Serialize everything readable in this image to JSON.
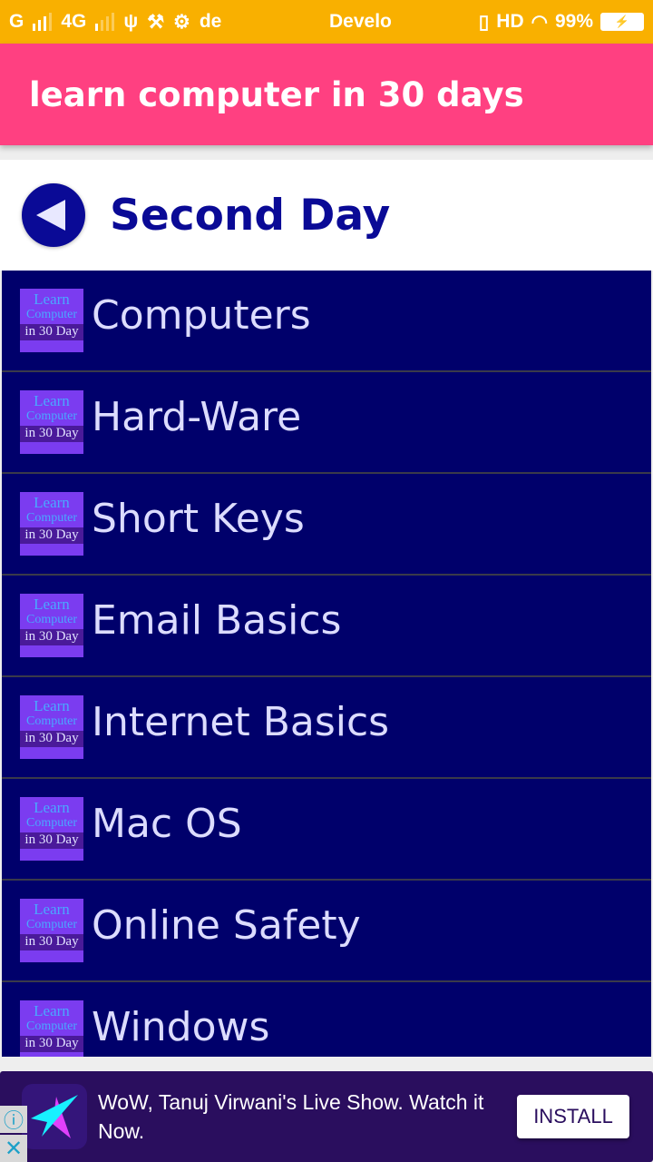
{
  "status_bar": {
    "network1": "G",
    "network2": "4G",
    "notif_text": "de",
    "center_text": "Develo",
    "hd": "HD",
    "battery_pct": "99%",
    "battery_charging": "⚡"
  },
  "app_bar": {
    "title": "learn computer in 30 days"
  },
  "header": {
    "title": "Second Day"
  },
  "thumbnail": {
    "line1": "Learn",
    "line2": "Computer",
    "line3": "in 30 Day"
  },
  "list": {
    "items": [
      {
        "label": "Computers"
      },
      {
        "label": "Hard-Ware"
      },
      {
        "label": "Short Keys"
      },
      {
        "label": "Email Basics"
      },
      {
        "label": "Internet Basics"
      },
      {
        "label": "Mac OS"
      },
      {
        "label": "Online Safety"
      },
      {
        "label": "Windows"
      }
    ]
  },
  "ad": {
    "text": "WoW, Tanuj Virwani's Live Show. Watch it Now.",
    "install_label": "INSTALL",
    "info_glyph": "ⓘ",
    "close_glyph": "✕"
  },
  "colors": {
    "status_bar": "#f9b000",
    "app_bar": "#ff4081",
    "primary_blue": "#0a0a96",
    "list_bg": "#00006b",
    "ad_bg": "#2a0e5e"
  }
}
